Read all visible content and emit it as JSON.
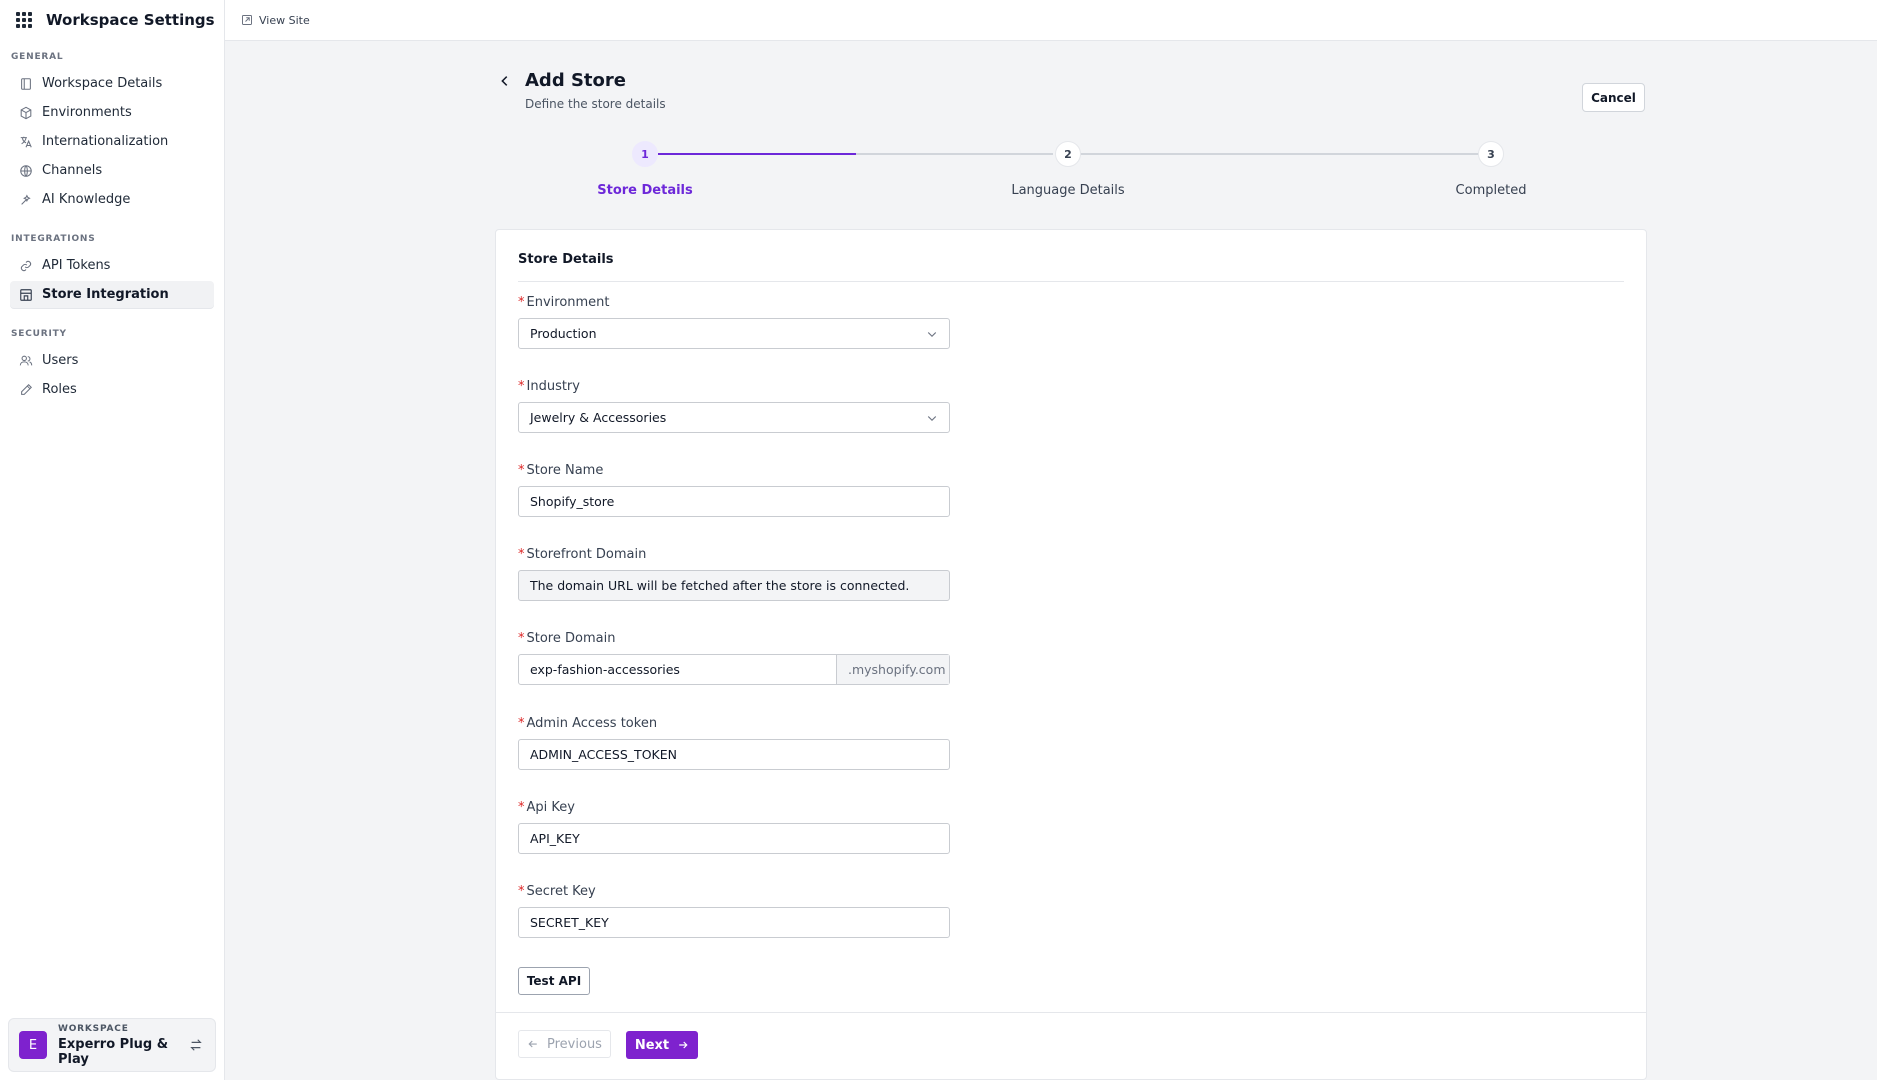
{
  "sidebar": {
    "title": "Workspace Settings",
    "sections": [
      {
        "label": "GENERAL",
        "items": [
          {
            "label": "Workspace Details",
            "icon": "document-icon"
          },
          {
            "label": "Environments",
            "icon": "cube-icon"
          },
          {
            "label": "Internationalization",
            "icon": "translate-icon"
          },
          {
            "label": "Channels",
            "icon": "globe-icon"
          },
          {
            "label": "AI Knowledge",
            "icon": "sparkle-icon"
          }
        ]
      },
      {
        "label": "INTEGRATIONS",
        "items": [
          {
            "label": "API Tokens",
            "icon": "link-icon"
          },
          {
            "label": "Store Integration",
            "icon": "store-icon",
            "active": true
          }
        ]
      },
      {
        "label": "SECURITY",
        "items": [
          {
            "label": "Users",
            "icon": "users-icon"
          },
          {
            "label": "Roles",
            "icon": "pencil-icon"
          }
        ]
      }
    ],
    "workspace": {
      "avatar_letter": "E",
      "label": "WORKSPACE",
      "name": "Experro Plug & Play"
    }
  },
  "topbar": {
    "view_site": "View Site"
  },
  "page": {
    "title": "Add Store",
    "subtitle": "Define the store details",
    "cancel": "Cancel"
  },
  "stepper": {
    "steps": [
      {
        "number": "1",
        "label": "Store Details",
        "active": true
      },
      {
        "number": "2",
        "label": "Language Details",
        "active": false
      },
      {
        "number": "3",
        "label": "Completed",
        "active": false
      }
    ]
  },
  "form": {
    "section_title": "Store Details",
    "fields": {
      "environment": {
        "label": "Environment",
        "value": "Production"
      },
      "industry": {
        "label": "Industry",
        "value": "Jewelry & Accessories"
      },
      "store_name": {
        "label": "Store Name",
        "value": "Shopify_store"
      },
      "storefront_domain": {
        "label": "Storefront Domain",
        "value": "The domain URL will be fetched after the store is connected."
      },
      "store_domain": {
        "label": "Store Domain",
        "value": "exp-fashion-accessories",
        "suffix": ".myshopify.com"
      },
      "admin_token": {
        "label": "Admin Access token",
        "value": "ADMIN_ACCESS_TOKEN"
      },
      "api_key": {
        "label": "Api Key",
        "value": "API_KEY"
      },
      "secret_key": {
        "label": "Secret Key",
        "value": "SECRET_KEY"
      }
    },
    "test_api": "Test API",
    "previous": "Previous",
    "next": "Next"
  },
  "colors": {
    "accent": "#7e22ce",
    "step_active": "#6d28d9",
    "required": "#dc2626"
  }
}
